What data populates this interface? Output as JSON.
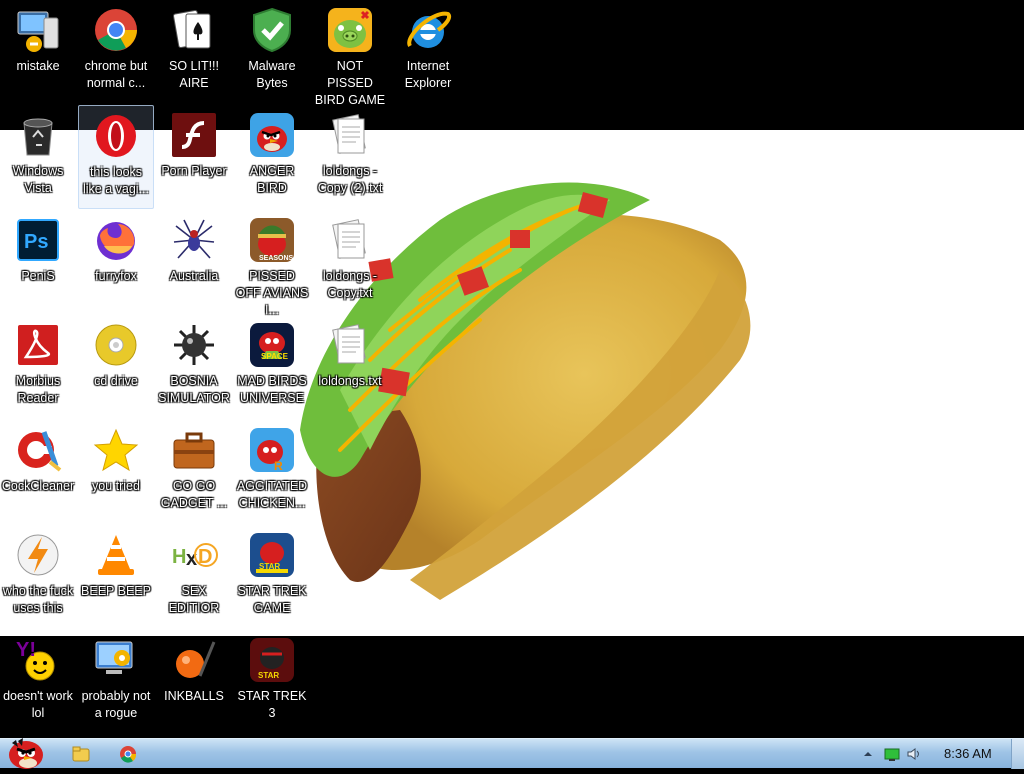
{
  "desktop": {
    "icons": [
      {
        "label": "mistake",
        "icon": "computer-icon"
      },
      {
        "label": "chrome but normal c...",
        "icon": "chrome-icon"
      },
      {
        "label": "SO LIT!!! AIRE",
        "icon": "solitaire-icon"
      },
      {
        "label": "Malware Bytes",
        "icon": "shield-icon"
      },
      {
        "label": "NOT PISSED BIRD GAME",
        "icon": "green-pig-icon"
      },
      {
        "label": "Internet Explorer",
        "icon": "ie-icon"
      },
      {
        "label": "Windows Vista",
        "icon": "recycle-bin-icon"
      },
      {
        "label": "this looks like a vagi...",
        "icon": "opera-icon"
      },
      {
        "label": "Porn Player",
        "icon": "flash-icon"
      },
      {
        "label": "ANGER BIRD",
        "icon": "angry-bird-icon"
      },
      {
        "label": "loldongs - Copy (2).txt",
        "icon": "text-file-icon"
      },
      {
        "label": "PeniS",
        "icon": "photoshop-icon"
      },
      {
        "label": "furryfox",
        "icon": "firefox-icon"
      },
      {
        "label": "Australia",
        "icon": "spider-icon"
      },
      {
        "label": "PISSED OFF AVIANS I...",
        "icon": "angry-birds-seasons-icon"
      },
      {
        "label": "loldongs - Copy.txt",
        "icon": "text-file-icon"
      },
      {
        "label": "Morbius Reader",
        "icon": "acrobat-icon"
      },
      {
        "label": "cd drive",
        "icon": "cd-icon"
      },
      {
        "label": "BOSNIA SIMULATOR",
        "icon": "mine-icon"
      },
      {
        "label": "MAD BIRDS UNIVERSE",
        "icon": "angry-birds-space-icon"
      },
      {
        "label": "loldongs.txt",
        "icon": "text-file-icon"
      },
      {
        "label": "CockCleaner",
        "icon": "ccleaner-icon"
      },
      {
        "label": "you tried",
        "icon": "star-icon"
      },
      {
        "label": "GO GO GADGET ...",
        "icon": "briefcase-icon"
      },
      {
        "label": "AGGITATED CHICKEN...",
        "icon": "angry-birds-rio-icon"
      },
      {
        "label": "who the fuck uses this",
        "icon": "winamp-icon"
      },
      {
        "label": "BEEP BEEP",
        "icon": "vlc-icon"
      },
      {
        "label": "SEX EDITIOR",
        "icon": "hxd-icon"
      },
      {
        "label": "STAR TREK GAME",
        "icon": "angry-birds-star-wars-icon"
      },
      {
        "label": "doesn't work lol",
        "icon": "yahoo-icon"
      },
      {
        "label": "probably not a rogue",
        "icon": "control-panel-icon"
      },
      {
        "label": "INKBALLS",
        "icon": "inkball-icon"
      },
      {
        "label": "STAR TREK 3",
        "icon": "angry-birds-star-wars-2-icon"
      }
    ]
  },
  "taskbar": {
    "start_icon": "angry-bird-start-icon",
    "pinned": [
      {
        "name": "explorer",
        "icon": "folder-icon"
      },
      {
        "name": "chrome",
        "icon": "chrome-icon"
      }
    ],
    "tray": [
      {
        "icon": "show-hidden-icons-icon"
      },
      {
        "icon": "network-icon"
      },
      {
        "icon": "volume-icon"
      }
    ],
    "clock": "8:36 AM"
  },
  "colors": {
    "desktop_bg": "#000000",
    "wallpaper_panel": "#ffffff",
    "taskbar_top": "#cde3f5",
    "taskbar_bottom": "#88b3dd"
  }
}
